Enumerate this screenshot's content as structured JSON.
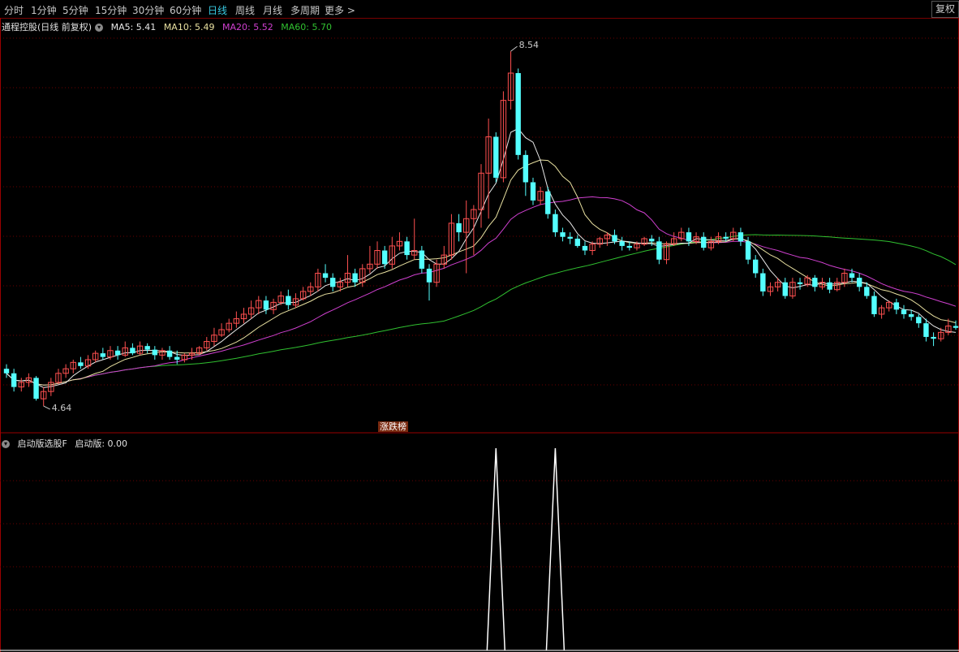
{
  "toolbar": {
    "periods": [
      "分时",
      "1分钟",
      "5分钟",
      "15分钟",
      "30分钟",
      "60分钟",
      "日线",
      "周线",
      "月线",
      "多周期",
      "更多 >"
    ],
    "active_period": "日线",
    "adjust_button": "复权"
  },
  "main_panel": {
    "stock_name": "通程控股(日线 前复权)",
    "ma": [
      {
        "label": "MA5: 5.41",
        "color": "#e8e8e8"
      },
      {
        "label": "MA10: 5.49",
        "color": "#e8e0a0"
      },
      {
        "label": "MA20: 5.52",
        "color": "#d040d0"
      },
      {
        "label": "MA60: 5.70",
        "color": "#30c030"
      }
    ],
    "high_label": "8.54",
    "low_label": "4.64",
    "badge": "涨跌榜"
  },
  "sub_panel": {
    "indicator_name": "启动版选股F",
    "value_label": "启动版: 0.00"
  },
  "colors": {
    "up": "#ff5050",
    "down": "#54ffff",
    "grid": "#6a0000",
    "ma5": "#e8e8e8",
    "ma10": "#e8e0a0",
    "ma20": "#d040d0",
    "ma60": "#30c030"
  },
  "chart_data": {
    "type": "candlestick",
    "y_range": [
      4.4,
      8.8
    ],
    "indicator_range": [
      0,
      1
    ],
    "high": 8.54,
    "low": 4.64,
    "indicator_spikes": [
      66,
      74
    ],
    "candles": [
      [
        5.05,
        5.0,
        5.1,
        4.95
      ],
      [
        5.0,
        4.85,
        5.05,
        4.8
      ],
      [
        4.85,
        4.9,
        4.95,
        4.8
      ],
      [
        4.9,
        4.95,
        5.0,
        4.85
      ],
      [
        4.95,
        4.72,
        4.97,
        4.7
      ],
      [
        4.72,
        4.8,
        4.85,
        4.64
      ],
      [
        4.8,
        4.9,
        4.95,
        4.75
      ],
      [
        4.9,
        5.0,
        5.05,
        4.88
      ],
      [
        5.0,
        5.05,
        5.1,
        4.95
      ],
      [
        5.05,
        5.12,
        5.15,
        5.0
      ],
      [
        5.12,
        5.08,
        5.18,
        5.05
      ],
      [
        5.08,
        5.15,
        5.2,
        5.05
      ],
      [
        5.15,
        5.22,
        5.25,
        5.12
      ],
      [
        5.22,
        5.18,
        5.28,
        5.15
      ],
      [
        5.18,
        5.25,
        5.3,
        5.15
      ],
      [
        5.25,
        5.2,
        5.3,
        5.15
      ],
      [
        5.2,
        5.28,
        5.35,
        5.18
      ],
      [
        5.28,
        5.22,
        5.33,
        5.2
      ],
      [
        5.22,
        5.3,
        5.35,
        5.2
      ],
      [
        5.3,
        5.26,
        5.33,
        5.22
      ],
      [
        5.26,
        5.2,
        5.3,
        5.15
      ],
      [
        5.2,
        5.25,
        5.28,
        5.15
      ],
      [
        5.25,
        5.18,
        5.3,
        5.15
      ],
      [
        5.18,
        5.15,
        5.25,
        5.1
      ],
      [
        5.15,
        5.2,
        5.22,
        5.12
      ],
      [
        5.2,
        5.22,
        5.28,
        5.15
      ],
      [
        5.22,
        5.28,
        5.3,
        5.2
      ],
      [
        5.28,
        5.35,
        5.4,
        5.25
      ],
      [
        5.35,
        5.42,
        5.5,
        5.3
      ],
      [
        5.42,
        5.48,
        5.55,
        5.4
      ],
      [
        5.48,
        5.55,
        5.6,
        5.45
      ],
      [
        5.55,
        5.6,
        5.68,
        5.5
      ],
      [
        5.6,
        5.65,
        5.72,
        5.55
      ],
      [
        5.65,
        5.72,
        5.8,
        5.6
      ],
      [
        5.72,
        5.8,
        5.85,
        5.65
      ],
      [
        5.8,
        5.7,
        5.85,
        5.65
      ],
      [
        5.7,
        5.78,
        5.82,
        5.65
      ],
      [
        5.78,
        5.85,
        5.9,
        5.75
      ],
      [
        5.85,
        5.75,
        5.92,
        5.7
      ],
      [
        5.75,
        5.82,
        5.88,
        5.72
      ],
      [
        5.82,
        5.9,
        5.95,
        5.8
      ],
      [
        5.9,
        5.95,
        6.0,
        5.85
      ],
      [
        5.95,
        6.1,
        6.15,
        5.9
      ],
      [
        6.1,
        6.05,
        6.2,
        6.0
      ],
      [
        6.05,
        5.95,
        6.1,
        5.9
      ],
      [
        5.95,
        6.0,
        6.05,
        5.9
      ],
      [
        6.0,
        6.1,
        6.3,
        5.95
      ],
      [
        6.1,
        6.0,
        6.15,
        5.95
      ],
      [
        6.0,
        6.15,
        6.2,
        5.95
      ],
      [
        6.15,
        6.2,
        6.4,
        6.1
      ],
      [
        6.2,
        6.35,
        6.45,
        6.15
      ],
      [
        6.35,
        6.2,
        6.4,
        6.15
      ],
      [
        6.2,
        6.4,
        6.5,
        6.15
      ],
      [
        6.4,
        6.45,
        6.55,
        6.35
      ],
      [
        6.45,
        6.3,
        6.5,
        6.25
      ],
      [
        6.3,
        6.35,
        6.7,
        6.25
      ],
      [
        6.35,
        6.15,
        6.4,
        6.1
      ],
      [
        6.15,
        6.0,
        6.2,
        5.8
      ],
      [
        6.0,
        6.2,
        6.25,
        5.95
      ],
      [
        6.2,
        6.3,
        6.4,
        6.15
      ],
      [
        6.3,
        6.65,
        6.75,
        6.25
      ],
      [
        6.65,
        6.55,
        6.75,
        6.45
      ],
      [
        6.55,
        6.7,
        6.9,
        6.1
      ],
      [
        6.7,
        6.8,
        6.85,
        6.3
      ],
      [
        6.8,
        7.2,
        7.3,
        6.6
      ],
      [
        7.2,
        7.6,
        7.8,
        6.7
      ],
      [
        7.6,
        7.15,
        7.65,
        7.1
      ],
      [
        7.15,
        8.0,
        8.1,
        7.1
      ],
      [
        8.0,
        8.3,
        8.54,
        7.9
      ],
      [
        8.3,
        7.4,
        8.35,
        7.35
      ],
      [
        7.4,
        7.1,
        7.45,
        6.95
      ],
      [
        7.1,
        6.9,
        7.15,
        6.85
      ],
      [
        6.9,
        7.0,
        7.05,
        6.85
      ],
      [
        7.0,
        6.75,
        7.05,
        6.7
      ],
      [
        6.75,
        6.55,
        6.8,
        6.5
      ],
      [
        6.55,
        6.5,
        6.6,
        6.45
      ],
      [
        6.5,
        6.48,
        6.55,
        6.42
      ],
      [
        6.48,
        6.4,
        6.52,
        6.38
      ],
      [
        6.4,
        6.35,
        6.45,
        6.3
      ],
      [
        6.35,
        6.42,
        6.45,
        6.3
      ],
      [
        6.42,
        6.48,
        6.5,
        6.38
      ],
      [
        6.48,
        6.52,
        6.55,
        6.4
      ],
      [
        6.52,
        6.45,
        6.58,
        6.42
      ],
      [
        6.45,
        6.4,
        6.5,
        6.35
      ],
      [
        6.4,
        6.38,
        6.45,
        6.35
      ],
      [
        6.38,
        6.42,
        6.45,
        6.35
      ],
      [
        6.42,
        6.48,
        6.5,
        6.4
      ],
      [
        6.48,
        6.45,
        6.52,
        6.4
      ],
      [
        6.45,
        6.25,
        6.5,
        6.2
      ],
      [
        6.25,
        6.42,
        6.45,
        6.2
      ],
      [
        6.42,
        6.48,
        6.55,
        6.4
      ],
      [
        6.48,
        6.55,
        6.6,
        6.45
      ],
      [
        6.55,
        6.45,
        6.6,
        6.4
      ],
      [
        6.45,
        6.5,
        6.55,
        6.42
      ],
      [
        6.5,
        6.38,
        6.55,
        6.35
      ],
      [
        6.38,
        6.45,
        6.5,
        6.35
      ],
      [
        6.45,
        6.5,
        6.55,
        6.42
      ],
      [
        6.5,
        6.48,
        6.55,
        6.45
      ],
      [
        6.48,
        6.55,
        6.6,
        6.45
      ],
      [
        6.55,
        6.45,
        6.6,
        6.4
      ],
      [
        6.45,
        6.25,
        6.5,
        6.2
      ],
      [
        6.25,
        6.1,
        6.3,
        6.05
      ],
      [
        6.1,
        5.9,
        6.15,
        5.85
      ],
      [
        5.9,
        5.95,
        6.0,
        5.85
      ],
      [
        5.95,
        6.0,
        6.05,
        5.9
      ],
      [
        6.0,
        5.85,
        6.05,
        5.82
      ],
      [
        5.85,
        6.0,
        6.05,
        5.82
      ],
      [
        6.0,
        5.98,
        6.05,
        5.92
      ],
      [
        5.98,
        6.05,
        6.08,
        5.95
      ],
      [
        6.05,
        5.95,
        6.08,
        5.9
      ],
      [
        5.95,
        6.0,
        6.05,
        5.92
      ],
      [
        6.0,
        5.92,
        6.05,
        5.88
      ],
      [
        5.92,
        6.0,
        6.05,
        5.9
      ],
      [
        6.0,
        6.1,
        6.15,
        5.95
      ],
      [
        6.1,
        6.05,
        6.15,
        6.0
      ],
      [
        6.05,
        5.95,
        6.1,
        5.9
      ],
      [
        5.95,
        5.85,
        6.0,
        5.82
      ],
      [
        5.85,
        5.65,
        5.9,
        5.62
      ],
      [
        5.65,
        5.72,
        5.75,
        5.6
      ],
      [
        5.72,
        5.78,
        5.8,
        5.68
      ],
      [
        5.78,
        5.7,
        5.82,
        5.65
      ],
      [
        5.7,
        5.65,
        5.75,
        5.6
      ],
      [
        5.65,
        5.62,
        5.7,
        5.58
      ],
      [
        5.62,
        5.55,
        5.65,
        5.5
      ],
      [
        5.55,
        5.4,
        5.6,
        5.35
      ],
      [
        5.4,
        5.38,
        5.45,
        5.3
      ],
      [
        5.38,
        5.45,
        5.5,
        5.35
      ],
      [
        5.45,
        5.52,
        5.6,
        5.42
      ],
      [
        5.52,
        5.5,
        5.58,
        5.48
      ]
    ]
  }
}
